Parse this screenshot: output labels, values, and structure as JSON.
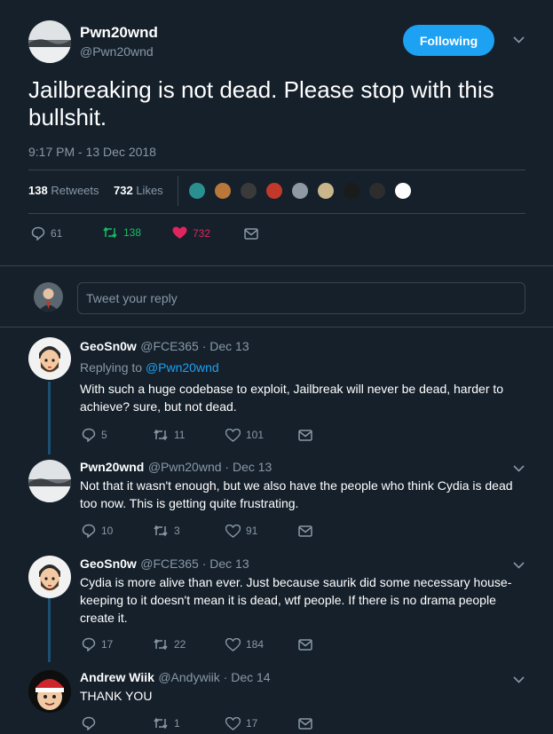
{
  "main_tweet": {
    "display_name": "Pwn20wnd",
    "handle": "@Pwn20wnd",
    "follow_label": "Following",
    "text": "Jailbreaking is not dead. Please stop with this bullshit.",
    "timestamp": "9:17 PM - 13 Dec 2018",
    "retweets_count": "138",
    "retweets_label": "Retweets",
    "likes_count": "732",
    "likes_label": "Likes",
    "actions": {
      "replies": "61",
      "retweets": "138",
      "likes": "732"
    }
  },
  "reply_box": {
    "placeholder": "Tweet your reply"
  },
  "replies": [
    {
      "name": "GeoSn0w",
      "meta": "@FCE365 · Dec 13",
      "replying_prefix": "Replying to ",
      "replying_to": "@Pwn20wnd",
      "text": "With such a huge codebase to exploit, Jailbreak will never be dead, harder to achieve? sure, but not dead.",
      "replies": "5",
      "retweets": "11",
      "likes": "101"
    },
    {
      "name": "Pwn20wnd",
      "meta": "@Pwn20wnd · Dec 13",
      "text": "Not that it wasn't enough, but we also have the people who think Cydia is dead too now. This is getting quite frustrating.",
      "replies": "10",
      "retweets": "3",
      "likes": "91"
    },
    {
      "name": "GeoSn0w",
      "meta": "@FCE365 · Dec 13",
      "text": "Cydia is more alive than ever. Just because saurik did some necessary house-keeping to it doesn't mean it is dead, wtf people. If there is no drama people create it.",
      "replies": "17",
      "retweets": "22",
      "likes": "184"
    },
    {
      "name": "Andrew Wiik",
      "meta": "@Andywiik · Dec 14",
      "text": "THANK YOU",
      "replies": "",
      "retweets": "1",
      "likes": "17"
    }
  ],
  "colors": {
    "accent": "#1da1f2",
    "retweet": "#17bf63",
    "like": "#e0245e",
    "muted": "#8899a6",
    "background": "#15202b"
  },
  "icons": [
    "chevron-down-icon",
    "reply-icon",
    "retweet-icon",
    "heart-icon",
    "mail-icon"
  ]
}
